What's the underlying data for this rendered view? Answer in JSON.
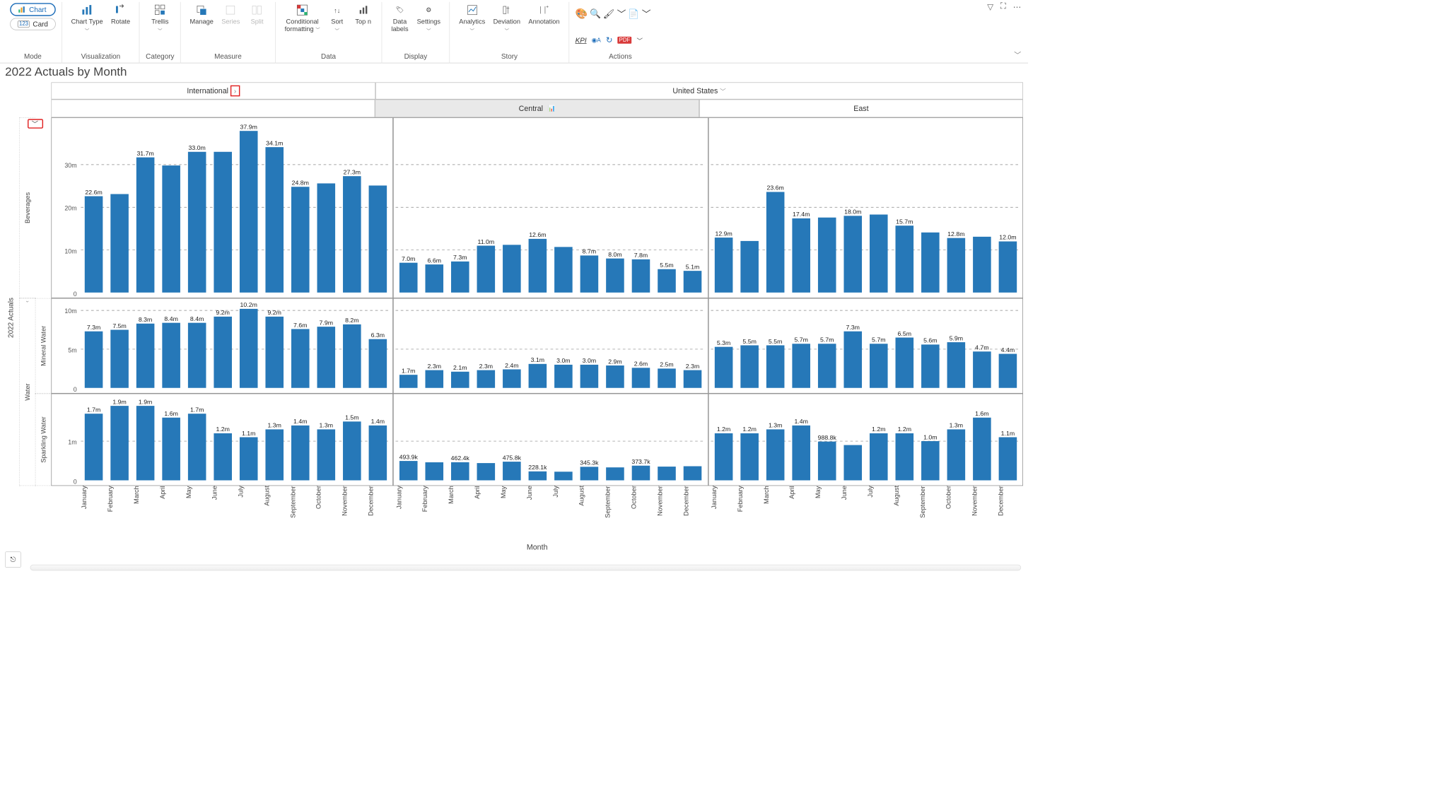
{
  "ribbon": {
    "mode_chart": "Chart",
    "mode_card": "Card",
    "mode_label": "Mode",
    "visualization": {
      "chart_type": "Chart Type",
      "rotate": "Rotate",
      "label": "Visualization"
    },
    "category": {
      "trellis": "Trellis",
      "label": "Category"
    },
    "measure": {
      "manage": "Manage",
      "series": "Series",
      "split": "Split",
      "label": "Measure"
    },
    "data": {
      "cond_fmt": "Conditional\nformatting",
      "sort": "Sort",
      "topn": "Top n",
      "label": "Data"
    },
    "display": {
      "data_labels": "Data\nlabels",
      "settings": "Settings",
      "label": "Display"
    },
    "story": {
      "analytics": "Analytics",
      "deviation": "Deviation",
      "annotation": "Annotation",
      "label": "Story"
    },
    "actions": {
      "kpi": "KPI",
      "label": "Actions"
    }
  },
  "title": "2022 Actuals by Month",
  "col_headers": [
    "International",
    "United States"
  ],
  "col_subheaders": [
    "Central",
    "East"
  ],
  "row_group": "Water",
  "row_labels": [
    "Beverages",
    "Mineral Water",
    "Sparkling Water"
  ],
  "months": [
    "January",
    "February",
    "March",
    "April",
    "May",
    "June",
    "July",
    "August",
    "September",
    "October",
    "November",
    "December"
  ],
  "ylabel": "2022 Actuals",
  "xlabel": "Month",
  "yticks": {
    "r0": [
      [
        0,
        "0"
      ],
      [
        10,
        "10m"
      ],
      [
        20,
        "20m"
      ],
      [
        30,
        "30m"
      ]
    ],
    "r1": [
      [
        0,
        "0"
      ],
      [
        5,
        "5m"
      ],
      [
        10,
        "10m"
      ]
    ],
    "r2": [
      [
        0,
        "0"
      ],
      [
        1,
        "1m"
      ]
    ]
  },
  "chart_data": {
    "type": "bar",
    "trellis": true,
    "categories": [
      "January",
      "February",
      "March",
      "April",
      "May",
      "June",
      "July",
      "August",
      "September",
      "October",
      "November",
      "December"
    ],
    "panels": [
      {
        "row": "Beverages",
        "col": "International",
        "ymax": 40,
        "values": [
          22.6,
          23.1,
          31.7,
          29.8,
          33.0,
          33.0,
          37.9,
          34.1,
          24.8,
          25.6,
          27.3,
          25.1
        ],
        "labels": [
          "22.6m",
          "",
          "31.7m",
          "",
          "33.0m",
          "",
          "37.9m",
          "34.1m",
          "24.8m",
          "",
          "27.3m",
          ""
        ]
      },
      {
        "row": "Beverages",
        "col": "Central",
        "ymax": 40,
        "values": [
          7.0,
          6.6,
          7.3,
          11.0,
          11.2,
          12.6,
          10.7,
          8.7,
          8.0,
          7.8,
          5.5,
          5.1
        ],
        "labels": [
          "7.0m",
          "6.6m",
          "7.3m",
          "11.0m",
          "",
          "12.6m",
          "",
          "8.7m",
          "8.0m",
          "7.8m",
          "5.5m",
          "5.1m"
        ]
      },
      {
        "row": "Beverages",
        "col": "East",
        "ymax": 40,
        "values": [
          12.9,
          12.1,
          23.6,
          17.4,
          17.6,
          18.0,
          18.3,
          15.7,
          14.1,
          12.8,
          13.1,
          12.0
        ],
        "labels": [
          "12.9m",
          "",
          "23.6m",
          "17.4m",
          "",
          "18.0m",
          "",
          "15.7m",
          "",
          "12.8m",
          "",
          "12.0m"
        ]
      },
      {
        "row": "Mineral Water",
        "col": "International",
        "ymax": 11,
        "values": [
          7.3,
          7.5,
          8.3,
          8.4,
          8.4,
          9.2,
          10.2,
          9.2,
          7.6,
          7.9,
          8.2,
          6.3
        ],
        "labels": [
          "7.3m",
          "7.5m",
          "8.3m",
          "8.4m",
          "8.4m",
          "9.2m",
          "10.2m",
          "9.2m",
          "7.6m",
          "7.9m",
          "8.2m",
          "6.3m"
        ]
      },
      {
        "row": "Mineral Water",
        "col": "Central",
        "ymax": 11,
        "values": [
          1.7,
          2.3,
          2.1,
          2.3,
          2.4,
          3.1,
          3.0,
          3.0,
          2.9,
          2.6,
          2.5,
          2.3
        ],
        "labels": [
          "1.7m",
          "2.3m",
          "2.1m",
          "2.3m",
          "2.4m",
          "3.1m",
          "3.0m",
          "3.0m",
          "2.9m",
          "2.6m",
          "2.5m",
          "2.3m"
        ]
      },
      {
        "row": "Mineral Water",
        "col": "East",
        "ymax": 11,
        "values": [
          5.3,
          5.5,
          5.5,
          5.7,
          5.7,
          7.3,
          5.7,
          6.5,
          5.6,
          5.9,
          4.7,
          4.4
        ],
        "labels": [
          "5.3m",
          "5.5m",
          "5.5m",
          "5.7m",
          "5.7m",
          "7.3m",
          "5.7m",
          "6.5m",
          "5.6m",
          "5.9m",
          "4.7m",
          "4.4m"
        ]
      },
      {
        "row": "Sparkling Water",
        "col": "International",
        "ymax": 2.1,
        "values": [
          1.7,
          1.9,
          1.9,
          1.6,
          1.7,
          1.2,
          1.1,
          1.3,
          1.4,
          1.3,
          1.5,
          1.4
        ],
        "labels": [
          "1.7m",
          "1.9m",
          "1.9m",
          "1.6m",
          "1.7m",
          "1.2m",
          "1.1m",
          "1.3m",
          "1.4m",
          "1.3m",
          "1.5m",
          "1.4m"
        ]
      },
      {
        "row": "Sparkling Water",
        "col": "Central",
        "ymax": 2.1,
        "values": [
          0.494,
          0.46,
          0.462,
          0.44,
          0.476,
          0.228,
          0.22,
          0.345,
          0.33,
          0.374,
          0.35,
          0.36
        ],
        "labels": [
          "493.9k",
          "",
          "462.4k",
          "",
          "475.8k",
          "228.1k",
          "",
          "345.3k",
          "",
          "373.7k",
          "",
          ""
        ]
      },
      {
        "row": "Sparkling Water",
        "col": "East",
        "ymax": 2.1,
        "values": [
          1.2,
          1.2,
          1.3,
          1.4,
          0.989,
          0.9,
          1.2,
          1.2,
          1.0,
          1.3,
          1.6,
          1.1
        ],
        "labels": [
          "1.2m",
          "1.2m",
          "1.3m",
          "1.4m",
          "988.8k",
          "",
          "1.2m",
          "1.2m",
          "1.0m",
          "1.3m",
          "1.6m",
          "1.1m"
        ]
      }
    ]
  }
}
